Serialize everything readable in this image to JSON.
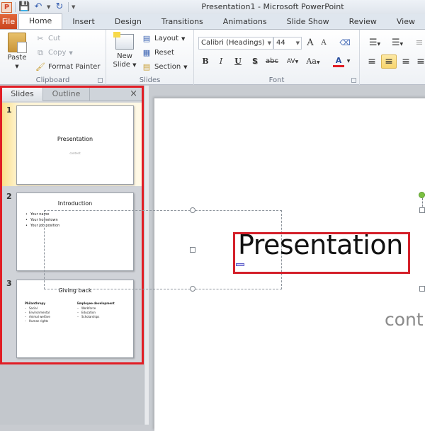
{
  "window": {
    "title": "Presentation1  -  Microsoft PowerPoint",
    "app_icon": "P"
  },
  "quick_access": {
    "save_icon": "floppy-disk-icon",
    "undo_icon": "undo-icon",
    "redo_icon": "redo-icon",
    "customize_icon": "customize-dropdown-icon"
  },
  "tabs": [
    {
      "label": "File"
    },
    {
      "label": "Home",
      "active": true
    },
    {
      "label": "Insert"
    },
    {
      "label": "Design"
    },
    {
      "label": "Transitions"
    },
    {
      "label": "Animations"
    },
    {
      "label": "Slide Show"
    },
    {
      "label": "Review"
    },
    {
      "label": "View"
    }
  ],
  "ribbon": {
    "clipboard": {
      "label": "Clipboard",
      "paste": "Paste",
      "cut": "Cut",
      "copy": "Copy",
      "format_painter": "Format Painter"
    },
    "slides": {
      "label": "Slides",
      "new_slide_line1": "New",
      "new_slide_line2": "Slide",
      "layout": "Layout",
      "reset": "Reset",
      "section": "Section"
    },
    "font": {
      "label": "Font",
      "font_name": "Calibri (Headings)",
      "font_size": "44",
      "grow": "A",
      "shrink": "A",
      "bold": "B",
      "italic": "I",
      "underline": "U",
      "shadow": "S",
      "strikethrough": "abc",
      "spacing": "AV",
      "change_case": "Aa",
      "font_color": "A",
      "font_color_hex": "#e01b22"
    },
    "paragraph": {
      "active_alignment": "center"
    }
  },
  "slides_pane": {
    "tab_slides": "Slides",
    "tab_outline": "Outline",
    "close": "×",
    "slides": [
      {
        "number": "1",
        "title": "Presentation",
        "subtitle": "content",
        "selected": true
      },
      {
        "number": "2",
        "title": "Introduction",
        "bullets": [
          "Your name",
          "Your hometown",
          "Your job position"
        ]
      },
      {
        "number": "3",
        "title": "Giving back",
        "columns": [
          {
            "heading": "Philanthropy",
            "items": [
              "Social",
              "Environmental",
              "Animal welfare",
              "Human rights"
            ]
          },
          {
            "heading": "Employee development",
            "items": [
              "Workforce",
              "Education",
              "Scholarships"
            ]
          }
        ]
      }
    ]
  },
  "editor": {
    "title_text": "Presentation",
    "subtitle_text": "cont",
    "highlight_color": "#d4202a",
    "rotation_handle_color": "#7cc142"
  }
}
